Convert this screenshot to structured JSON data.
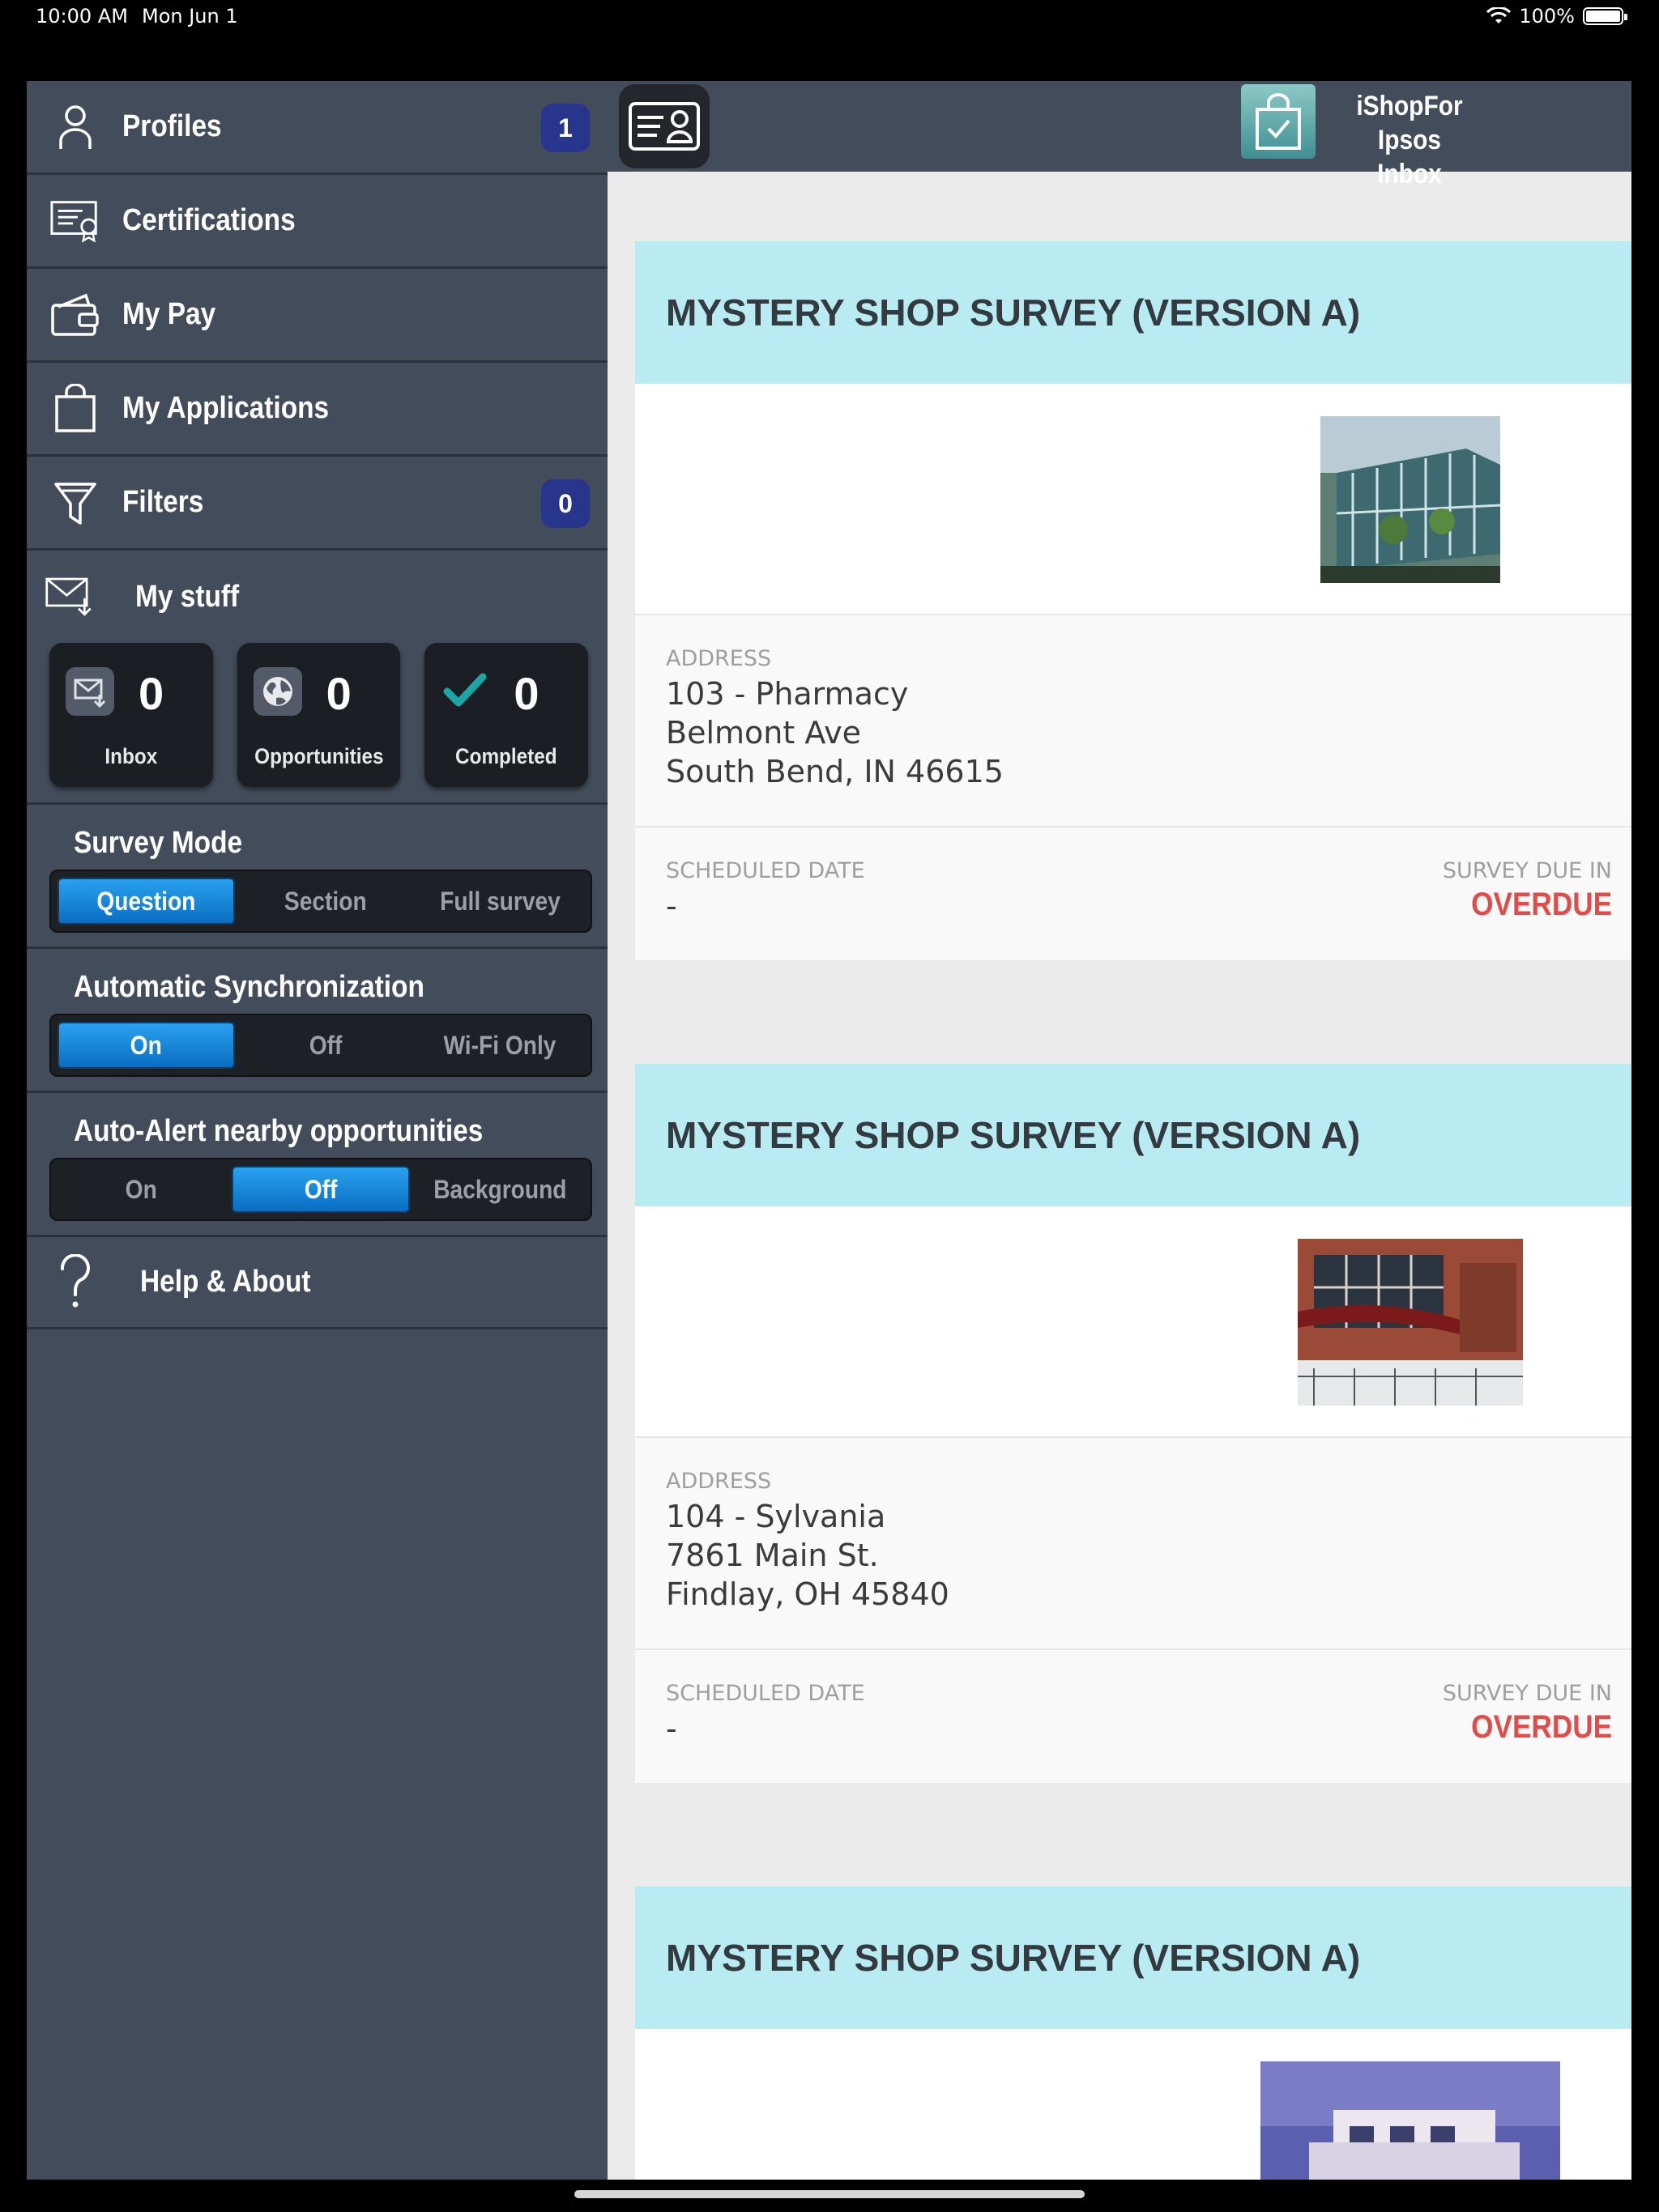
{
  "status": {
    "time": "10:00 AM",
    "date": "Mon Jun 1",
    "battery": "100%"
  },
  "sidebar": {
    "menu": [
      {
        "label": "Profiles",
        "badge": "1"
      },
      {
        "label": "Certifications"
      },
      {
        "label": "My Pay"
      },
      {
        "label": "My Applications"
      },
      {
        "label": "Filters",
        "badge": "0"
      }
    ],
    "mystuff": {
      "title": "My stuff",
      "tiles": [
        {
          "count": "0",
          "label": "Inbox"
        },
        {
          "count": "0",
          "label": "Opportunities"
        },
        {
          "count": "0",
          "label": "Completed"
        }
      ]
    },
    "survey_mode": {
      "title": "Survey Mode",
      "options": [
        "Question",
        "Section",
        "Full survey"
      ],
      "selected": "Question"
    },
    "sync": {
      "title": "Automatic Synchronization",
      "options": [
        "On",
        "Off",
        "Wi-Fi Only"
      ],
      "selected": "On"
    },
    "alert": {
      "title": "Auto-Alert nearby opportunities",
      "options": [
        "On",
        "Off",
        "Background"
      ],
      "selected": "Off"
    },
    "help": {
      "label": "Help & About"
    }
  },
  "header": {
    "brand_line1": "iShopFor Ipsos",
    "brand_line2": "Inbox"
  },
  "cards": [
    {
      "title": "MYSTERY SHOP SURVEY (VERSION A)",
      "address_label": "ADDRESS",
      "address": [
        "103 - Pharmacy",
        "Belmont Ave",
        "South Bend, IN 46615"
      ],
      "scheduled_label": "SCHEDULED DATE",
      "scheduled_value": "-",
      "due_label": "SURVEY DUE IN",
      "due_value": "OVERDUE"
    },
    {
      "title": "MYSTERY SHOP SURVEY (VERSION A)",
      "address_label": "ADDRESS",
      "address": [
        "104 - Sylvania",
        "7861 Main St.",
        "Findlay, OH 45840"
      ],
      "scheduled_label": "SCHEDULED DATE",
      "scheduled_value": "-",
      "due_label": "SURVEY DUE IN",
      "due_value": "OVERDUE"
    },
    {
      "title": "MYSTERY SHOP SURVEY (VERSION A)"
    }
  ],
  "colors": {
    "sidebar_bg": "#434c5a",
    "badge": "#27358c",
    "card_header": "#b9ecf2",
    "overdue": "#e24b47",
    "segment_active": "#1a87d9"
  }
}
